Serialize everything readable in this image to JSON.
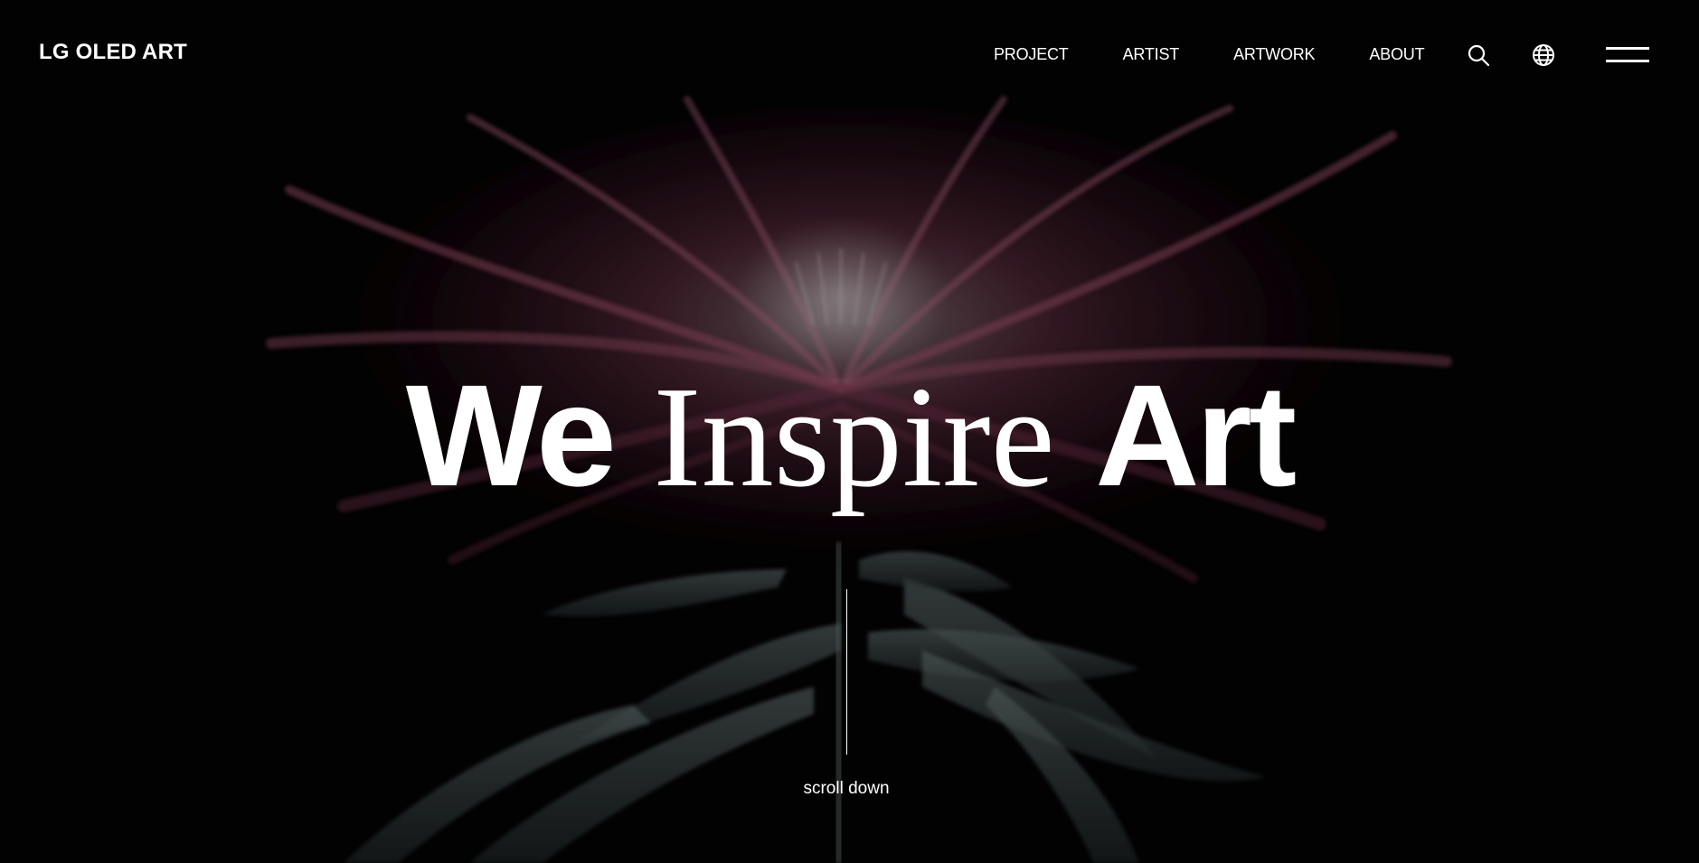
{
  "header": {
    "logo": "LG OLED ART",
    "nav": [
      "PROJECT",
      "ARTIST",
      "ARTWORK",
      "ABOUT"
    ],
    "icons": [
      "search-icon",
      "globe-icon",
      "menu-icon"
    ]
  },
  "hero": {
    "headline_part1": "We",
    "headline_part2": "Inspire",
    "headline_part3": "Art",
    "scroll_label": "scroll down"
  },
  "colors": {
    "background": "#040304",
    "text": "#ffffff",
    "petal": "#b04a6e",
    "leaf": "#4a5a5a"
  }
}
